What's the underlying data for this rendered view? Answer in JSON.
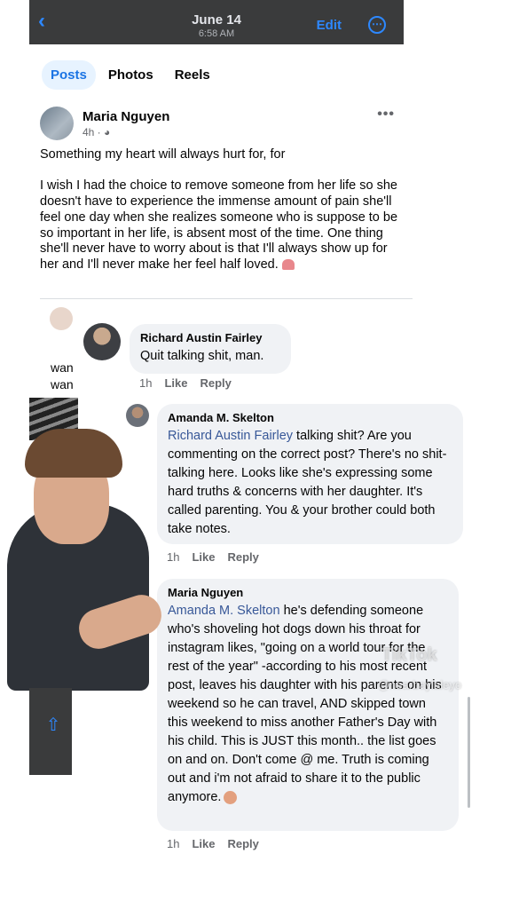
{
  "header": {
    "date": "June 14",
    "time": "6:58 AM",
    "edit_label": "Edit"
  },
  "tabs": [
    {
      "label": "Posts",
      "active": true
    },
    {
      "label": "Photos",
      "active": false
    },
    {
      "label": "Reels",
      "active": false
    }
  ],
  "post": {
    "author": "Maria Nguyen",
    "age": "4h ·",
    "paragraph1": "Something my heart will always hurt for, for",
    "paragraph2": "I wish I had the choice to remove someone from her life so she doesn't have to experience the immense amount of pain she'll feel one day when she realizes someone who is suppose to be so important in her life, is absent most of the time. One thing she'll never have to worry about is that I'll always show up for her and I'll never make her feel half loved."
  },
  "partial_comment": {
    "line1": "wan",
    "line2": "wan"
  },
  "comments": [
    {
      "author": "Richard Austin Fairley",
      "text": "Quit talking shit, man.",
      "age": "1h",
      "like": "Like",
      "reply": "Reply"
    },
    {
      "author": "Amanda M. Skelton",
      "mention": "Richard Austin Fairley",
      "text": " talking shit? Are you commenting on the correct post? There's no shit-talking here. Looks like she's expressing some hard truths & concerns with her daughter. It's called parenting. You & your brother could both take notes.",
      "age": "1h",
      "like": "Like",
      "reply": "Reply"
    },
    {
      "author": "Maria Nguyen",
      "mention": "Amanda M. Skelton",
      "text": " he's defending someone who's shoveling hot dogs down his throat for instagram likes, \"going on a world tour for the rest of the year\" -according to his most recent post, leaves his daughter with his parents on his weekend so he can travel, AND skipped town this weekend to miss another Father's Day with his child. This is JUST this month.. the list goes on and on. Don't come @ me. Truth is coming out and i'm not afraid to share it to the public anymore.",
      "age": "1h",
      "like": "Like",
      "reply": "Reply"
    }
  ],
  "overlay": {
    "watermark": "TikTok",
    "handle": "@nearbaylaleyo"
  },
  "colors": {
    "accent": "#1b74e4",
    "mention": "#385898",
    "bubble": "#f0f2f5",
    "topbar": "#3a3b3c"
  },
  "icons": [
    "back-chevron-icon",
    "more-circle-icon",
    "globe-icon",
    "ellipsis-icon",
    "heart-emoji-icon",
    "share-icon",
    "face-emoji-icon"
  ]
}
